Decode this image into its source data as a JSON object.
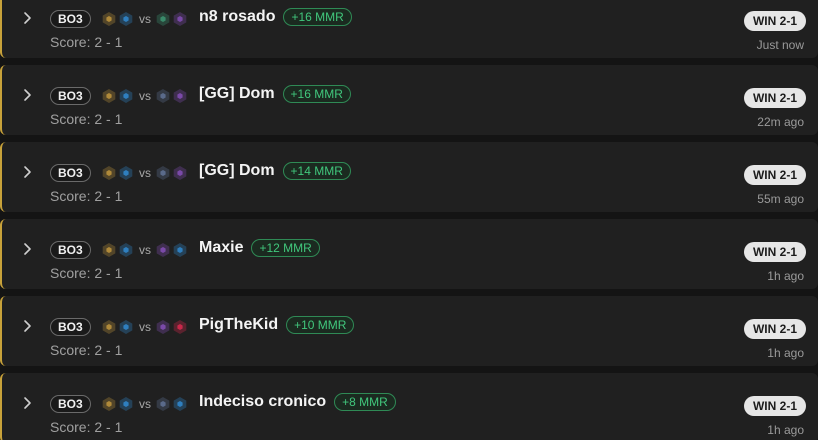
{
  "matches": [
    {
      "format": "BO3",
      "vs": "vs",
      "opponent": "n8 rosado",
      "mmr": "+16 MMR",
      "score": "Score: 2 - 1",
      "result": "WIN 2-1",
      "time": "Just now",
      "my_icons": [
        "#b08a3a",
        "#2f7fbf"
      ],
      "opp_icons": [
        "#3a8a6a",
        "#7a4aa8"
      ]
    },
    {
      "format": "BO3",
      "vs": "vs",
      "opponent": "[GG] Dom",
      "mmr": "+16 MMR",
      "score": "Score: 2 - 1",
      "result": "WIN 2-1",
      "time": "22m ago",
      "my_icons": [
        "#b08a3a",
        "#2f7fbf"
      ],
      "opp_icons": [
        "#5a6a8a",
        "#7a4aa8"
      ]
    },
    {
      "format": "BO3",
      "vs": "vs",
      "opponent": "[GG] Dom",
      "mmr": "+14 MMR",
      "score": "Score: 2 - 1",
      "result": "WIN 2-1",
      "time": "55m ago",
      "my_icons": [
        "#b08a3a",
        "#2f7fbf"
      ],
      "opp_icons": [
        "#5a6a8a",
        "#7a4aa8"
      ]
    },
    {
      "format": "BO3",
      "vs": "vs",
      "opponent": "Maxie",
      "mmr": "+12 MMR",
      "score": "Score: 2 - 1",
      "result": "WIN 2-1",
      "time": "1h ago",
      "my_icons": [
        "#b08a3a",
        "#2f7fbf"
      ],
      "opp_icons": [
        "#7a4aa8",
        "#2f7fbf"
      ]
    },
    {
      "format": "BO3",
      "vs": "vs",
      "opponent": "PigTheKid",
      "mmr": "+10 MMR",
      "score": "Score: 2 - 1",
      "result": "WIN 2-1",
      "time": "1h ago",
      "my_icons": [
        "#b08a3a",
        "#2f7fbf"
      ],
      "opp_icons": [
        "#7a4aa8",
        "#c8284a"
      ]
    },
    {
      "format": "BO3",
      "vs": "vs",
      "opponent": "Indeciso cronico",
      "mmr": "+8 MMR",
      "score": "Score: 2 - 1",
      "result": "WIN 2-1",
      "time": "1h ago",
      "my_icons": [
        "#b08a3a",
        "#2f7fbf"
      ],
      "opp_icons": [
        "#5a6a8a",
        "#2f7fbf"
      ]
    }
  ]
}
